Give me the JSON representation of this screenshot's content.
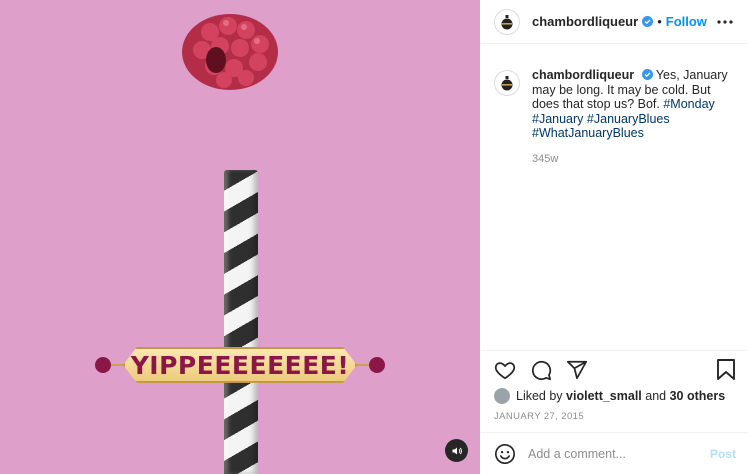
{
  "post": {
    "username": "chambordliqueur",
    "follow_label": "Follow",
    "dot": "•",
    "verified": true
  },
  "media": {
    "banner_text": "YIPPEEEEEEEE!",
    "colors": {
      "background": "#df9fcb",
      "banner": "#eccb7c",
      "banner_text": "#8a1748"
    }
  },
  "caption": {
    "username": "chambordliqueur",
    "text": "Yes, January may be long. It may be cold. But does that stop us? Bof.",
    "hashtags": [
      "#Monday",
      "#January",
      "#JanuaryBlues",
      "#WhatJanuaryBlues"
    ],
    "time_ago": "345w"
  },
  "likes": {
    "prefix": "Liked by",
    "user": "violett_small",
    "conjunction": "and",
    "others": "30 others"
  },
  "date": "JANUARY 27, 2015",
  "comment": {
    "placeholder": "Add a comment...",
    "post_label": "Post"
  },
  "icons": {
    "emoji": "smiley-icon",
    "like": "heart-icon",
    "comment": "comment-icon",
    "share": "send-icon",
    "save": "bookmark-icon",
    "more": "more-dots-icon",
    "sound": "speaker-icon"
  }
}
